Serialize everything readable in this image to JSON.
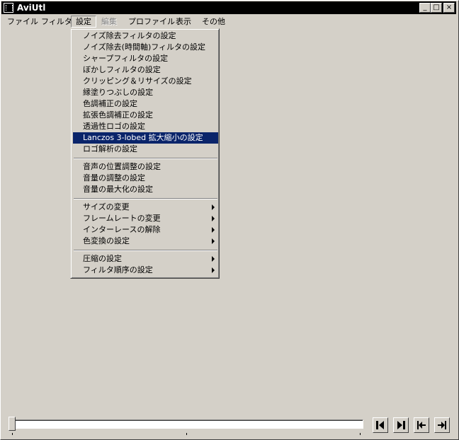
{
  "window": {
    "title": "AviUtl"
  },
  "title_buttons": [
    {
      "icon": "minimize-icon",
      "glyph": "_"
    },
    {
      "icon": "maximize-icon",
      "glyph": "□"
    },
    {
      "icon": "close-icon",
      "glyph": "×"
    }
  ],
  "menubar": {
    "items": [
      {
        "label": "ファイル"
      },
      {
        "label": "フィルタ"
      },
      {
        "label": "設定"
      },
      {
        "label": "編集"
      },
      {
        "label": "プロファイル"
      },
      {
        "label": "表示"
      },
      {
        "label": "その他"
      }
    ]
  },
  "settings_menu": {
    "items": [
      {
        "label": "ノイズ除去フィルタの設定"
      },
      {
        "label": "ノイズ除去(時間軸)フィルタの設定"
      },
      {
        "label": "シャープフィルタの設定"
      },
      {
        "label": "ぼかしフィルタの設定"
      },
      {
        "label": "クリッピング＆リサイズの設定"
      },
      {
        "label": "縁塗りつぶしの設定"
      },
      {
        "label": "色調補正の設定"
      },
      {
        "label": "拡張色調補正の設定"
      },
      {
        "label": "透過性ロゴの設定"
      },
      {
        "label": "Lanczos 3-lobed 拡大縮小の設定"
      },
      {
        "label": "ロゴ解析の設定"
      },
      {
        "label": "音声の位置調整の設定"
      },
      {
        "label": "音量の調整の設定"
      },
      {
        "label": "音量の最大化の設定"
      },
      {
        "label": "サイズの変更"
      },
      {
        "label": "フレームレートの変更"
      },
      {
        "label": "インターレースの解除"
      },
      {
        "label": "色変換の設定"
      },
      {
        "label": "圧縮の設定"
      },
      {
        "label": "フィルタ順序の設定"
      }
    ],
    "highlighted_item": "Lanczos 3-lobed 拡大縮小の設定",
    "highlight_color": "#0a246a"
  },
  "timeline": {
    "position": 0
  },
  "nav_buttons": [
    {
      "icon": "previous-frame-icon"
    },
    {
      "icon": "next-frame-icon"
    },
    {
      "icon": "first-frame-icon"
    },
    {
      "icon": "last-frame-icon"
    }
  ]
}
